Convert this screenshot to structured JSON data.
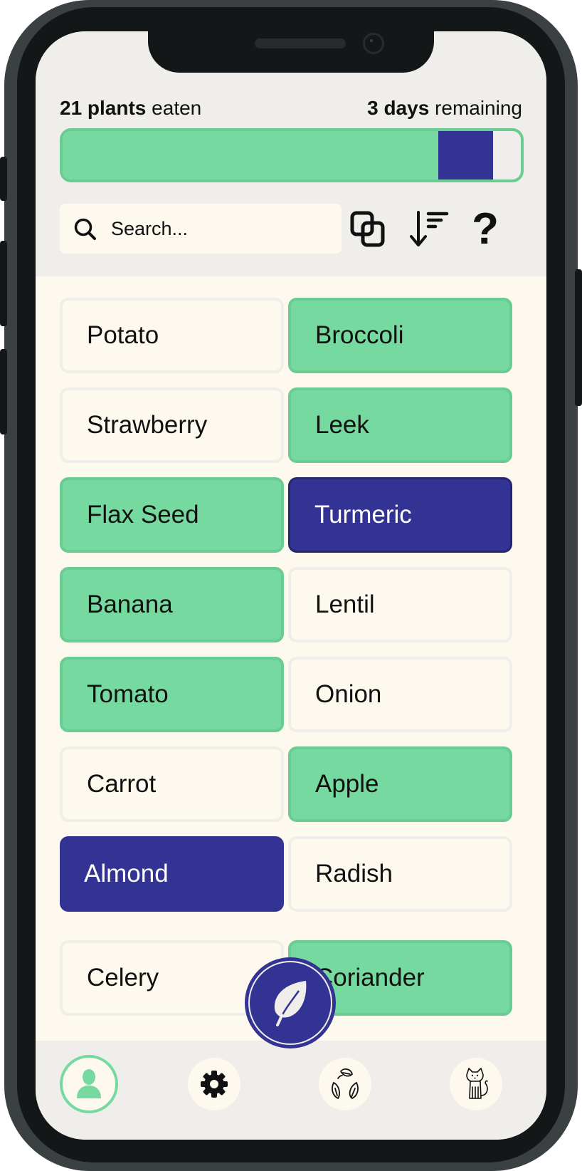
{
  "header": {
    "eaten_count": "21 plants",
    "eaten_suffix": " eaten",
    "days_count": "3 days",
    "days_suffix": " remaining",
    "progress": {
      "eaten_fraction": 0.82,
      "today_fraction": 0.12
    }
  },
  "search": {
    "placeholder": "Search...",
    "value": ""
  },
  "toolbar": {
    "icons": [
      "filter-overlap-icon",
      "sort-descending-icon",
      "help-icon"
    ],
    "help_glyph": "?"
  },
  "colors": {
    "eaten": "#76d9a0",
    "today": "#333393",
    "card_bg": "#fdf9ef",
    "screen_bg": "#efeeeb"
  },
  "plants": [
    {
      "name": "Potato",
      "state": "none"
    },
    {
      "name": "Broccoli",
      "state": "eaten"
    },
    {
      "name": "Strawberry",
      "state": "none"
    },
    {
      "name": "Leek",
      "state": "eaten"
    },
    {
      "name": "Flax Seed",
      "state": "eaten"
    },
    {
      "name": "Turmeric",
      "state": "today"
    },
    {
      "name": "Banana",
      "state": "eaten"
    },
    {
      "name": "Lentil",
      "state": "none"
    },
    {
      "name": "Tomato",
      "state": "eaten"
    },
    {
      "name": "Onion",
      "state": "none"
    },
    {
      "name": "Carrot",
      "state": "none"
    },
    {
      "name": "Apple",
      "state": "eaten"
    },
    {
      "name": "Almond",
      "state": "today"
    },
    {
      "name": "Radish",
      "state": "none"
    },
    {
      "name": "Celery",
      "state": "none"
    },
    {
      "name": "Coriander",
      "state": "eaten"
    }
  ],
  "fab": {
    "icon": "leaf-icon"
  },
  "nav": {
    "items": [
      {
        "name": "profile",
        "icon": "user-icon",
        "active": true
      },
      {
        "name": "settings",
        "icon": "gear-icon",
        "active": false
      },
      {
        "name": "recycle",
        "icon": "leaf-cycle-icon",
        "active": false
      },
      {
        "name": "pet",
        "icon": "cat-icon",
        "active": false
      }
    ]
  }
}
